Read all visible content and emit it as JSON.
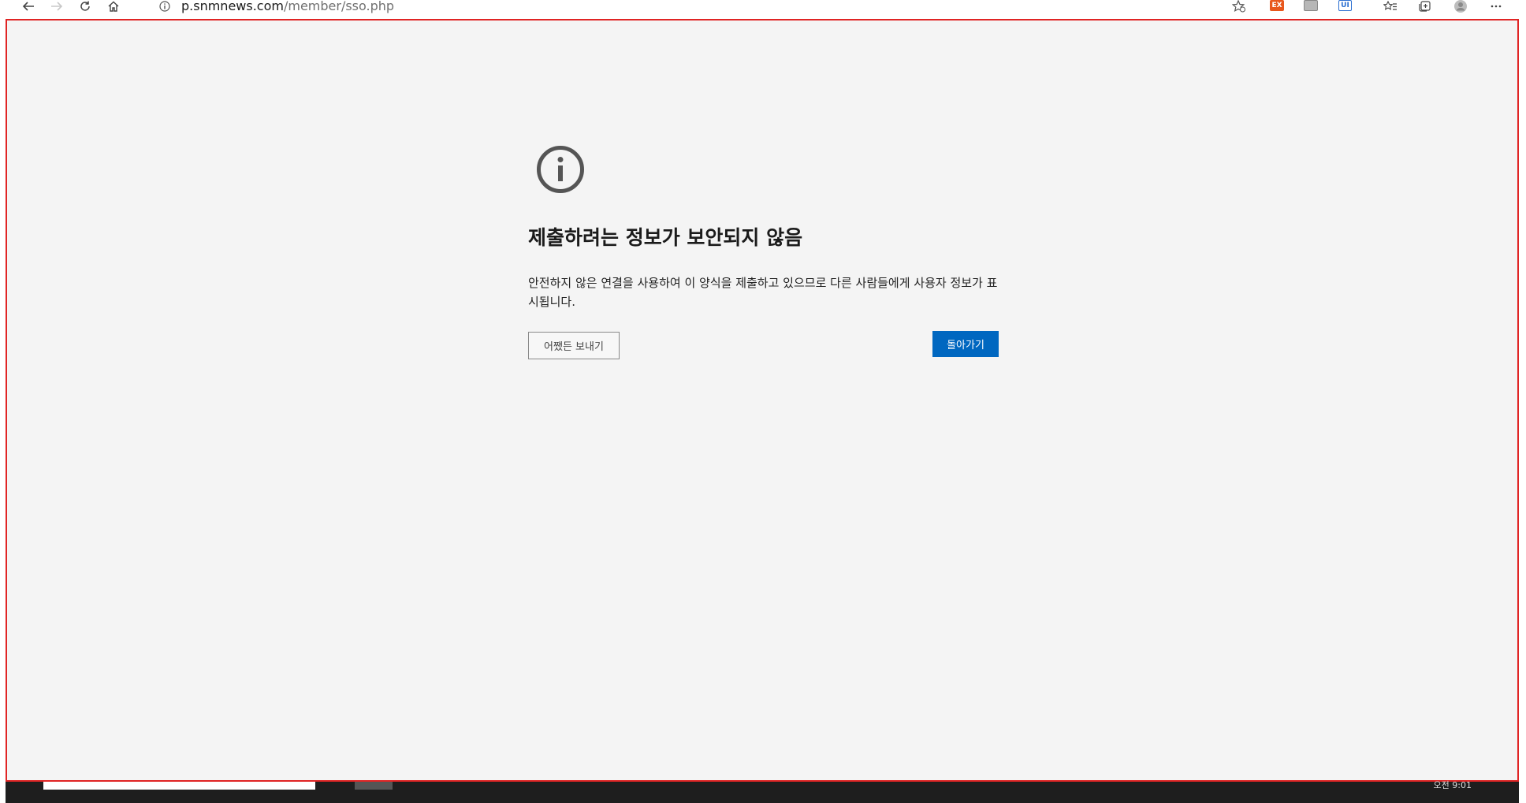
{
  "browser": {
    "url_host": "p.snmnews.com",
    "url_path": "/member/sso.php",
    "address_icon": "info-circle-icon",
    "nav": {
      "back_icon": "back-arrow-icon",
      "forward_icon": "forward-arrow-icon",
      "refresh_icon": "refresh-icon",
      "home_icon": "home-icon"
    },
    "toolbar_icons": [
      "add-favorite-icon",
      "extension-orange-icon",
      "extension-gray-icon",
      "extension-blue-icon",
      "favorites-icon",
      "collections-icon",
      "profile-avatar-icon",
      "more-menu-icon"
    ],
    "extension_labels": {
      "orange": "EX",
      "blue": "UI"
    }
  },
  "page": {
    "heading": "제출하려는 정보가 보안되지 않음",
    "description": "안전하지 않은 연결을 사용하여 이 양식을 제출하고 있으므로 다른 사람들에게 사용자 정보가 표시됩니다.",
    "send_anyway_label": "어쨌든 보내기",
    "go_back_label": "돌아가기"
  },
  "colors": {
    "page_background": "#f4f4f4",
    "frame_border": "#e02424",
    "primary_button": "#0067c0",
    "icon": "#555555"
  },
  "taskbar": {
    "clock": "오전 9:01"
  }
}
